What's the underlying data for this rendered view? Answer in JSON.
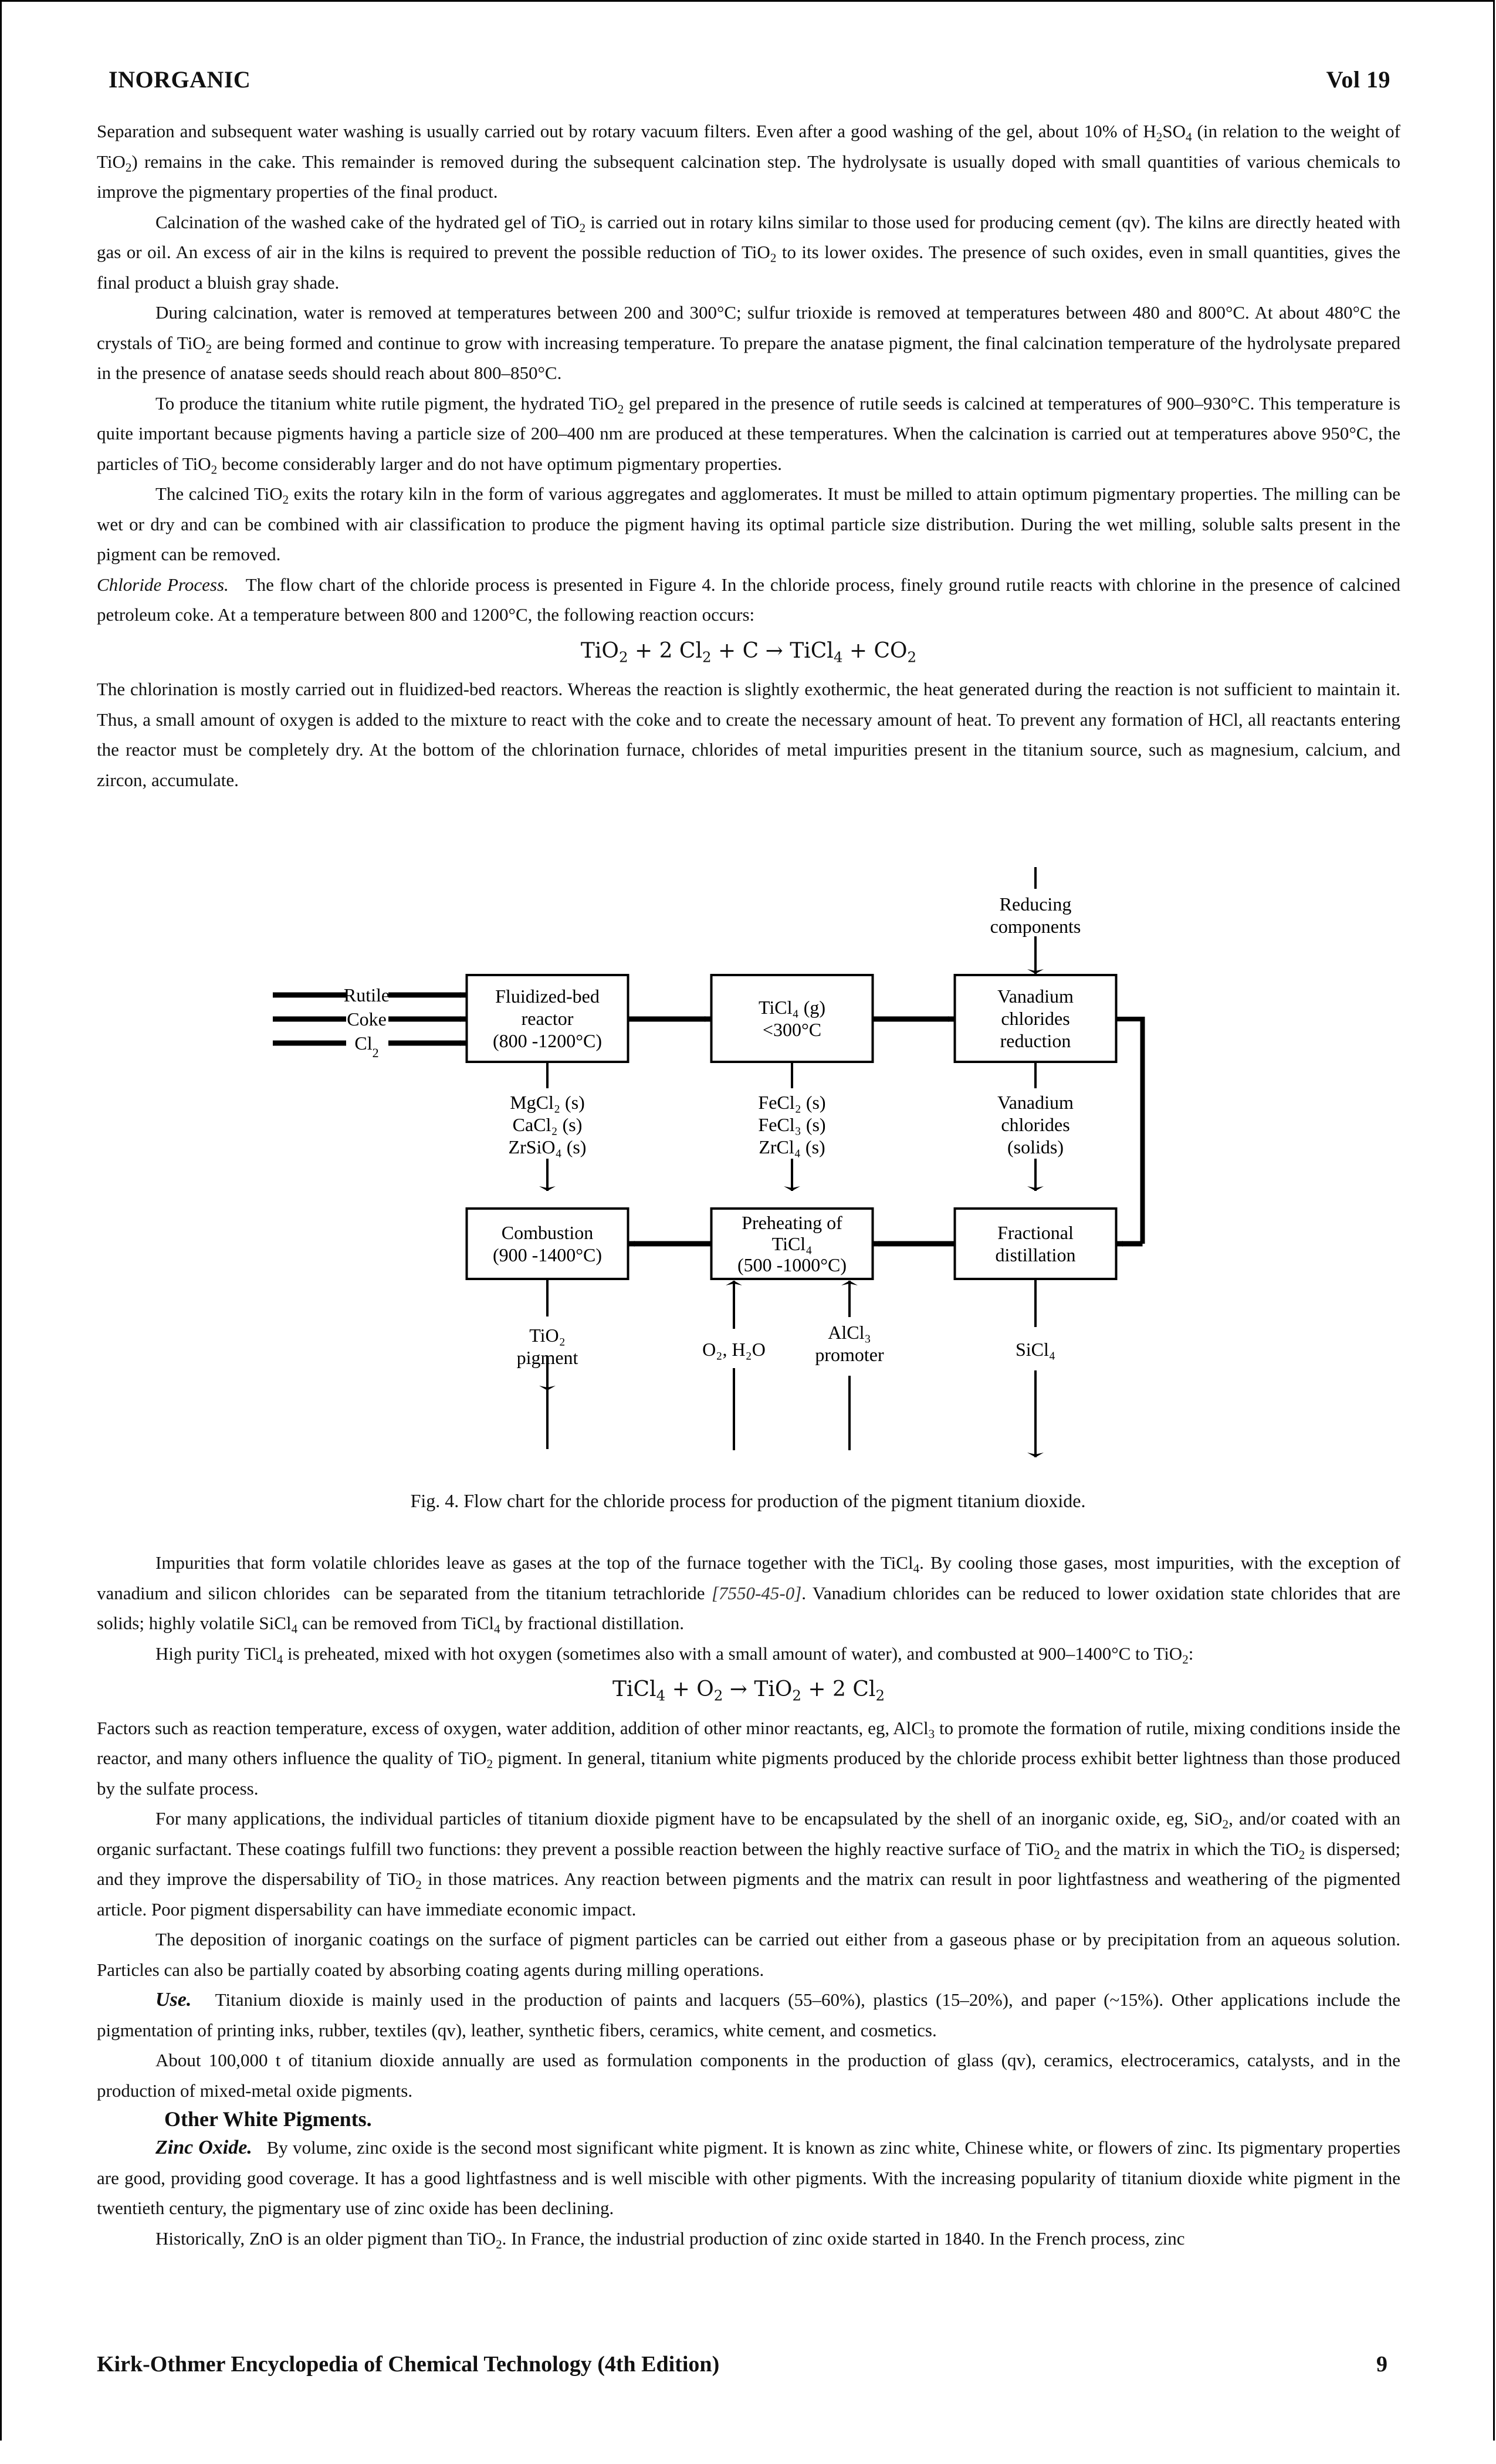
{
  "header": {
    "left": "INORGANIC",
    "right": "Vol 19"
  },
  "footer": {
    "left": "Kirk-Othmer Encyclopedia of Chemical Technology (4th Edition)",
    "page_number": "9"
  },
  "paragraphs_top": [
    {
      "id": "p1",
      "indent": false,
      "html": "Separation and subsequent water washing is usually carried out by rotary vacuum filters. Even after a good washing of the gel, about 10% of H<sub>2</sub>SO<sub>4</sub> (in relation to the weight of TiO<sub>2</sub>) remains in the cake. This remainder is removed during the subsequent calcination step. The hydrolysate is usually doped with small quantities of various chemicals to improve the pigmentary properties of the final product."
    },
    {
      "id": "p2",
      "indent": true,
      "html": "Calcination of the washed cake of the hydrated gel of TiO<sub>2</sub> is carried out in rotary kilns similar to those used for producing cement (qv). The kilns are directly heated with gas or oil. An excess of air in the kilns is required to prevent the possible reduction of TiO<sub>2</sub> to its lower oxides. The presence of such oxides, even in small quantities, gives the final product a bluish gray shade."
    },
    {
      "id": "p3",
      "indent": true,
      "html": "During calcination, water is removed at temperatures between 200 and 300°C; sulfur trioxide is removed at temperatures between 480 and 800°C. At about 480°C the crystals of TiO<sub>2</sub> are being formed and continue to grow with increasing temperature. To prepare the anatase pigment, the final calcination temperature of the hydrolysate prepared in the presence of anatase seeds should reach about 800–850°C."
    },
    {
      "id": "p4",
      "indent": true,
      "html": "To produce the titanium white rutile pigment, the hydrated TiO<sub>2</sub> gel prepared in the presence of rutile seeds is calcined at temperatures of 900–930°C. This temperature is quite important because pigments having a particle size of 200–400 nm are produced at these temperatures. When the calcination is carried out at temperatures above 950°C, the particles of TiO<sub>2</sub> become considerably larger and do not have optimum pigmentary properties."
    },
    {
      "id": "p5",
      "indent": true,
      "html": "The calcined TiO<sub>2</sub> exits the rotary kiln in the form of various aggregates and agglomerates. It must be milled to attain optimum pigmentary properties. The milling can be wet or dry and can be combined with air classification to produce the pigment having its optimal particle size distribution. During the wet milling, soluble salts present in the pigment can be removed."
    },
    {
      "id": "p6",
      "indent": false,
      "runin": "Chloride Process.",
      "html": "The flow chart of the chloride process is presented in Figure 4. In the chloride process, finely ground rutile reacts with chlorine in the presence of calcined petroleum coke. At a temperature between 800 and 1200°C, the following reaction occurs:"
    },
    {
      "id": "eq1",
      "equation": true,
      "html": "TiO<sub>2</sub> + 2 Cl<sub>2</sub> + C → TiCl<sub>4</sub> + CO<sub>2</sub>"
    },
    {
      "id": "p7",
      "indent": false,
      "html": "The chlorination is mostly carried out in fluidized-bed reactors. Whereas the reaction is slightly exothermic, the heat generated during the reaction is not sufficient to maintain it. Thus, a small amount of oxygen is added to the mixture to react with the coke and to create the necessary amount of heat. To prevent any formation of HCl, all reactants entering the reactor must be completely dry. At the bottom of the chlorination furnace, chlorides of metal impurities present in the titanium source, such as magnesium, calcium, and zircon, accumulate."
    }
  ],
  "figure": {
    "caption": "Fig. 4. Flow chart for the chloride process for production of the pigment titanium dioxide.",
    "inputs": [
      "Rutile",
      "Coke",
      "Cl<tspan baseline-shift='sub' font-size='22'>2</tspan>"
    ],
    "reducing_label": [
      "Reducing",
      "components"
    ],
    "boxes": {
      "reactor": [
        "Fluidized-bed",
        "reactor",
        "(800 -1200°C)"
      ],
      "ticl4": [
        "TiCl₄ (g)",
        "<300°C"
      ],
      "vanadium_reduction": [
        "Vanadium",
        "chlorides",
        "reduction"
      ],
      "combustion": [
        "Combustion",
        "(900 -1400°C)"
      ],
      "preheating": [
        "Preheating of",
        "TiCl₄",
        "(500 -1000°C)"
      ],
      "distillation": [
        "Fractional",
        "distillation"
      ]
    },
    "byproducts": {
      "reactor": [
        "MgCl₂ (s)",
        "CaCl₂ (s)",
        "ZrSiO₄ (s)"
      ],
      "ticl4": [
        "FeCl₂ (s)",
        "FeCl₃ (s)",
        "ZrCl₄ (s)"
      ],
      "vanadium": [
        "Vanadium",
        "chlorides",
        "(solids)"
      ]
    },
    "outputs": {
      "tio2": [
        "TiO₂",
        "pigment"
      ],
      "o2h2o": [
        "O₂, H₂O"
      ],
      "alcl3": [
        "AlCl₃",
        "promoter"
      ],
      "sicl4": [
        "SiCl₄"
      ]
    }
  },
  "paragraphs_bottom": [
    {
      "id": "p8",
      "indent": true,
      "html": "Impurities that form volatile chlorides leave as gases at the top of the furnace together with the TiCl<sub>4</sub>. By cooling those gases, most impurities, with the exception of vanadium and silicon chlorides&nbsp; can be separated from the titanium tetrachloride <span class='cas'>[7550-45-0]</span>. Vanadium chlorides can be reduced to lower oxidation state chlorides that are solids; highly volatile SiCl<sub>4</sub> can be removed from TiCl<sub>4</sub> by fractional distillation."
    },
    {
      "id": "p9",
      "indent": true,
      "html": "High purity TiCl<sub>4</sub> is preheated, mixed with hot oxygen (sometimes also with a small amount of water), and combusted at 900–1400°C to TiO<sub>2</sub>:"
    },
    {
      "id": "eq2",
      "equation": true,
      "html": "TiCl<sub>4</sub> + O<sub>2</sub> → TiO<sub>2</sub> + 2 Cl<sub>2</sub>"
    },
    {
      "id": "p10",
      "indent": false,
      "html": "Factors such as reaction temperature, excess of oxygen, water addition, addition of other minor reactants, eg, AlCl<sub>3</sub> to promote the formation of rutile, mixing conditions inside the reactor, and many others influence the quality of TiO<sub>2</sub> pigment. In general, titanium white pigments produced by the chloride process exhibit better lightness than those produced by the sulfate process."
    },
    {
      "id": "p11",
      "indent": true,
      "html": "For many applications, the individual particles of titanium dioxide pigment have to be encapsulated by the shell of an inorganic oxide, eg, SiO<sub>2</sub>, and/or coated with an organic surfactant. These coatings fulfill two functions: they prevent a possible reaction between the highly reactive surface of TiO<sub>2</sub> and the matrix in which the TiO<sub>2</sub> is dispersed; and they improve the dispersability of TiO<sub>2</sub> in those matrices. Any reaction between pigments and the matrix can result in poor lightfastness and weathering of the pigmented article. Poor pigment dispersability can have immediate economic impact."
    },
    {
      "id": "p12",
      "indent": true,
      "html": "The deposition of inorganic coatings on the surface of pigment particles can be carried out either from a gaseous phase or by precipitation from an aqueous solution. Particles can also be partially coated by absorbing coating agents during milling operations."
    },
    {
      "id": "p13",
      "indent": true,
      "runin_bold": "Use.",
      "html": "Titanium dioxide is mainly used in the production of paints and lacquers (55–60%), plastics (15–20%), and paper (~15%). Other applications include the pigmentation of printing inks, rubber, textiles (qv), leather, synthetic fibers, ceramics, white cement, and cosmetics."
    },
    {
      "id": "p14",
      "indent": true,
      "html": "About 100,000 t of titanium dioxide annually are used as formulation components in the production of glass (qv), ceramics, electroceramics, catalysts, and in the production of mixed-metal oxide pigments."
    },
    {
      "id": "h1",
      "heading": true,
      "html": "Other White Pigments."
    },
    {
      "id": "p15",
      "indent": true,
      "runin_bold": "Zinc Oxide.",
      "html": "By volume, zinc oxide is the second most significant white pigment. It is known as zinc white, Chinese white, or flowers of zinc. Its pigmentary properties are good, providing good coverage. It has a good lightfastness and is well miscible with other pigments. With the increasing popularity of titanium dioxide white pigment in the twentieth century, the pigmentary use of zinc oxide has been declining."
    },
    {
      "id": "p16",
      "indent": true,
      "html": "Historically, ZnO is an older pigment than TiO<sub>2</sub>. In France, the industrial production of zinc oxide started in 1840. In the French process, zinc"
    }
  ]
}
